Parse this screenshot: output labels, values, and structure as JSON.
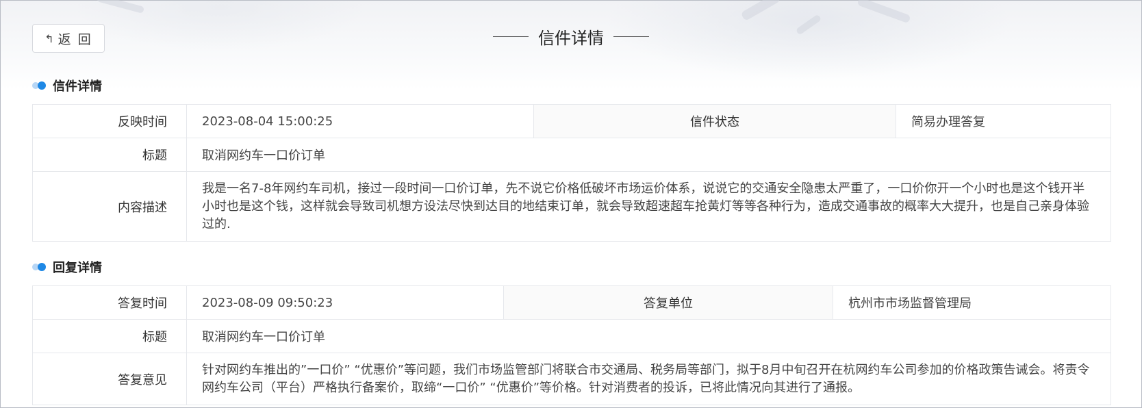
{
  "back_label": "返 回",
  "page_title": "信件详情",
  "letter_section": {
    "title": "信件详情",
    "time_label": "反映时间",
    "time_value": "2023-08-04 15:00:25",
    "status_label": "信件状态",
    "status_value": "简易办理答复",
    "subject_label": "标题",
    "subject_value": "取消网约车一口价订单",
    "content_label": "内容描述",
    "content_value": "我是一名7-8年网约车司机，接过一段时间一口价订单，先不说它价格低破坏市场运价体系，说说它的交通安全隐患太严重了，一口价你开一个小时也是这个钱开半小时也是这个钱，这样就会导致司机想方设法尽快到达目的地结束订单，就会导致超速超车抢黄灯等等各种行为，造成交通事故的概率大大提升，也是自己亲身体验过的."
  },
  "reply_section": {
    "title": "回复详情",
    "time_label": "答复时间",
    "time_value": "2023-08-09 09:50:23",
    "unit_label": "答复单位",
    "unit_value": "杭州市市场监督管理局",
    "subject_label": "标题",
    "subject_value": "取消网约车一口价订单",
    "opinion_label": "答复意见",
    "opinion_value": "针对网约车推出的”一口价” “优惠价”等问题，我们市场监管部门将联合市交通局、税务局等部门，拟于8月中旬召开在杭网约车公司参加的价格政策告诫会。将责令网约车公司（平台）严格执行备案价，取缔“一口价” “优惠价”等价格。针对消费者的投诉，已将此情况向其进行了通报。"
  }
}
